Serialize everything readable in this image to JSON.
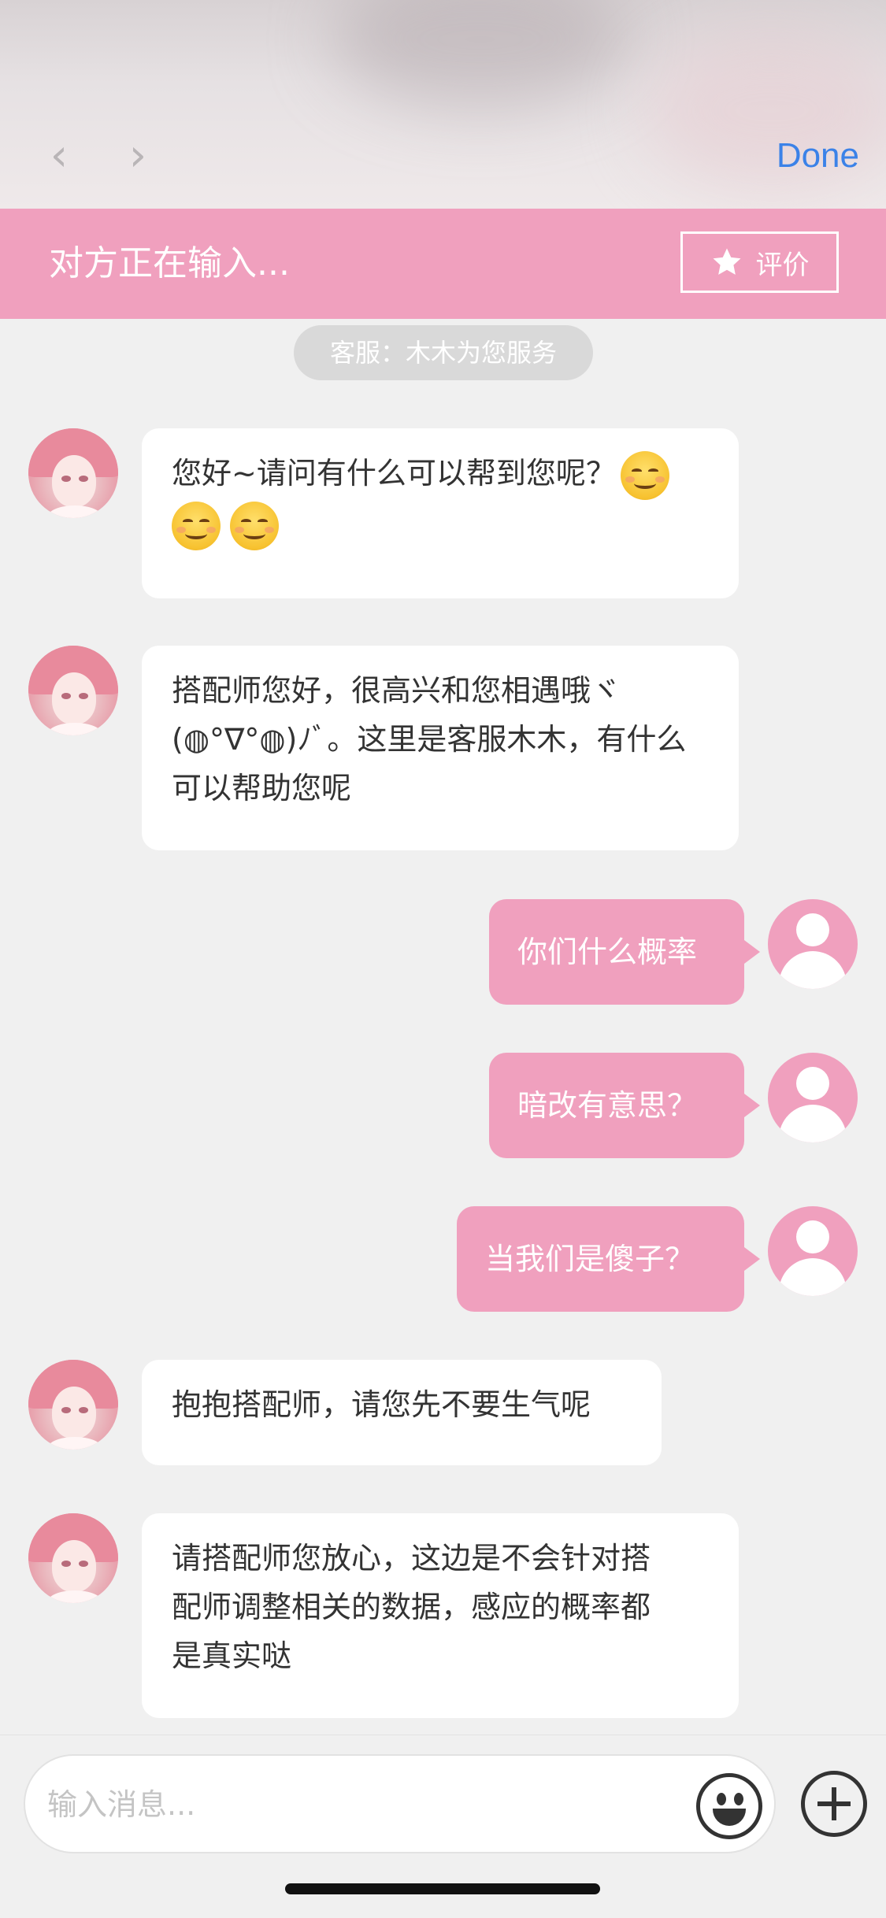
{
  "nav": {
    "back_glyph": "‹",
    "forward_glyph": "›",
    "done_label": "Done"
  },
  "header": {
    "status": "对方正在输入...",
    "rate_label": "评价",
    "rate_icon": "star-icon",
    "background_color": "#f0a0be"
  },
  "service_pill": "客服：木木为您服务",
  "messages": [
    {
      "side": "left",
      "text": "您好~请问有什么可以帮到您呢？",
      "emoji_count_line1": 1,
      "emoji_count_line2": 2
    },
    {
      "side": "left",
      "lines": [
        "搭配师您好，很高兴和您相遇哦ヾ",
        "(◍°∇°◍)ﾉﾞ。这里是客服木木，有什么",
        "可以帮助您呢"
      ]
    },
    {
      "side": "right",
      "text": "你们什么概率"
    },
    {
      "side": "right",
      "text": "暗改有意思？"
    },
    {
      "side": "right",
      "text": "当我们是傻子？"
    },
    {
      "side": "left",
      "text": "抱抱搭配师，请您先不要生气呢"
    },
    {
      "side": "left",
      "lines": [
        "请搭配师您放心，这边是不会针对搭",
        "配师调整相关的数据，感应的概率都",
        "是真实哒"
      ]
    }
  ],
  "composer": {
    "placeholder": "输入消息...",
    "emoji_icon": "smiley-icon",
    "add_icon": "plus-circle-icon"
  },
  "colors": {
    "accent_pink": "#f0a0be",
    "done_blue": "#3b82e8",
    "background": "#f0f0f0"
  }
}
